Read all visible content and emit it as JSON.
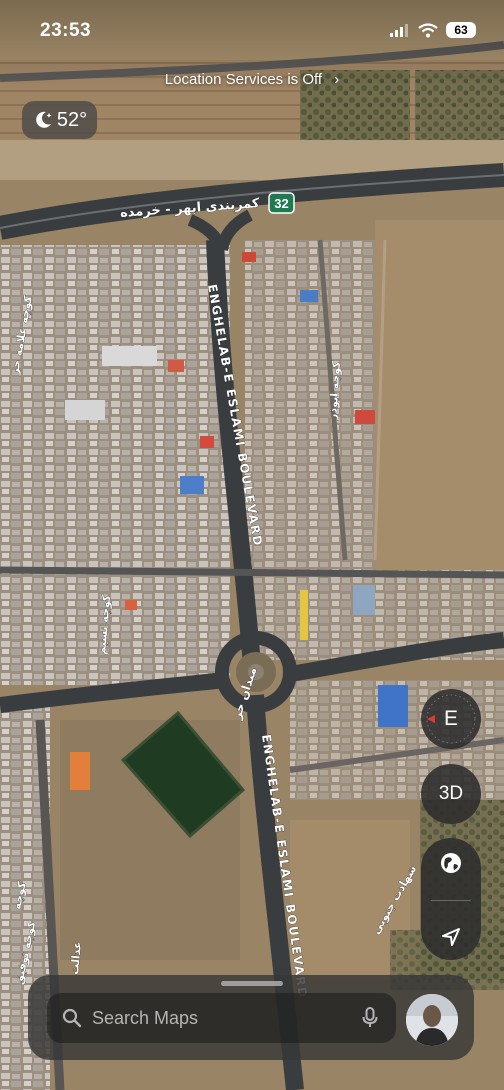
{
  "status_bar": {
    "time": "23:53",
    "battery": "63"
  },
  "banner": {
    "location_services": "Location Services is Off"
  },
  "weather": {
    "temperature": "52°",
    "icon": "moon-icon"
  },
  "map": {
    "highway_shield": "32",
    "highway_name": "کمربندی ابهر - خرمده",
    "boulevard_name_north": "ENGHELAB-E ESLAMI BOULEVARD",
    "boulevard_name_south": "ENGHELAB-E ESLAMI BOULEVARD",
    "square_name": "میدان حر",
    "street_left_1": "کوچه علامه حر",
    "street_center_1": "کوچه ابوذر",
    "street_center_2": "کوچه نسیم",
    "street_lower_1": "کوچه",
    "street_lower_2": "کوچه توفیق",
    "street_lower_3": "عدالت",
    "street_lower_right": "شهادت جنوبی"
  },
  "controls": {
    "compass_heading": "E",
    "view_toggle": "3D"
  },
  "search": {
    "placeholder": "Search Maps"
  },
  "colors": {
    "water": "#1f3b22",
    "roof_blue": "#3f74c8",
    "roof_orange": "#e27f3a",
    "road": "#3a3d3f"
  }
}
